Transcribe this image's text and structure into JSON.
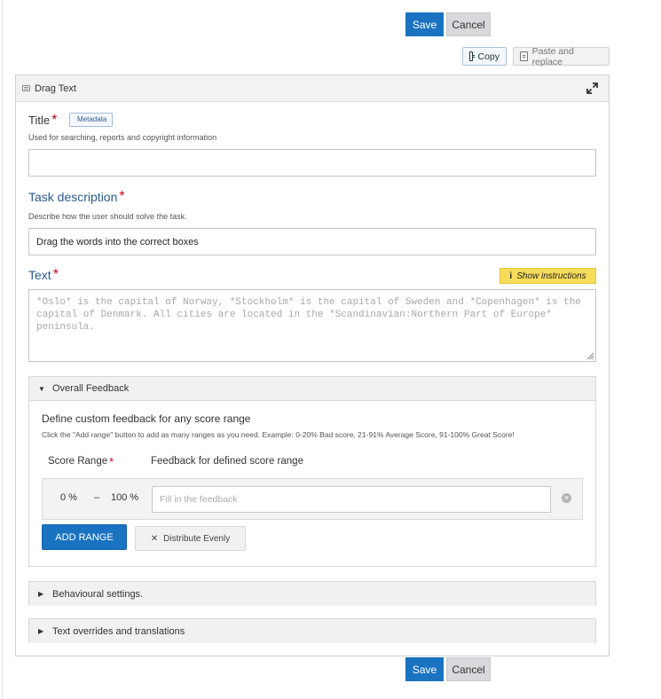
{
  "top_buttons": {
    "save": "Save",
    "cancel": "Cancel"
  },
  "clipboard": {
    "copy": "Copy",
    "paste": "Paste and replace"
  },
  "panel": {
    "title": "Drag Text"
  },
  "fields": {
    "title": {
      "label": "Title",
      "required": "*",
      "metadata": "Metadata",
      "description": "Used for searching, reports and copyright information",
      "value": ""
    },
    "task": {
      "label": "Task description",
      "required": "*",
      "description": "Describe how the user should solve the task.",
      "value": "Drag the words into the correct boxes"
    },
    "text": {
      "label": "Text",
      "required": "*",
      "show_instructions": "Show instructions",
      "info_glyph": "i",
      "placeholder": "*Oslo* is the capital of Norway, *Stockholm* is the capital of Sweden and *Copenhagen* is the capital of Denmark. All cities are located in the *Scandinavian:Northern Part of Europe* peninsula."
    }
  },
  "overall_feedback": {
    "header": "Overall Feedback",
    "title": "Define custom feedback for any score range",
    "description": "Click the \"Add range\" button to add as many ranges as you need. Example: 0-20% Bad score, 21-91% Average Score, 91-100% Great Score!",
    "col_score": "Score Range",
    "col_score_required": "*",
    "col_feedback": "Feedback for defined score range",
    "row": {
      "from": "0 %",
      "dash": "–",
      "to": "100 %",
      "placeholder": "Fill in the feedback"
    },
    "add_range": "ADD RANGE",
    "distribute": "Distribute Evenly"
  },
  "groups": {
    "behaviour": "Behavioural settings.",
    "overrides": "Text overrides and translations"
  },
  "bottom_buttons": {
    "save": "Save",
    "cancel": "Cancel"
  },
  "colors": {
    "primary": "#1a73c1",
    "required": "#d0021b",
    "instructions": "#f6dc5a"
  }
}
